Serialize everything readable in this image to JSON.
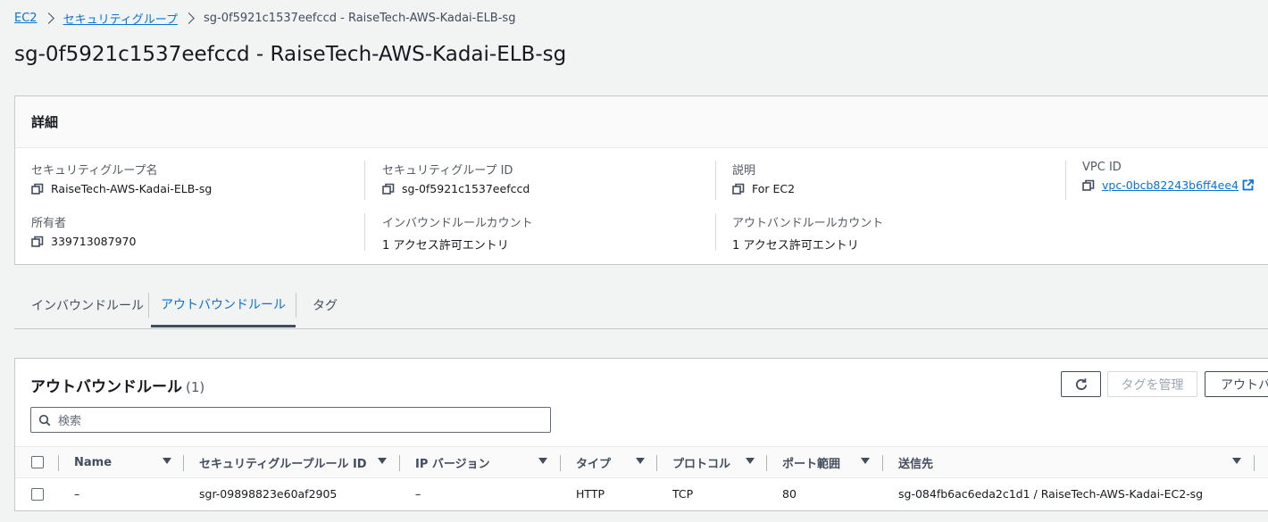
{
  "breadcrumb": {
    "items": [
      "EC2",
      "セキュリティグループ"
    ],
    "current": "sg-0f5921c1537eefccd - RaiseTech-AWS-Kadai-ELB-sg"
  },
  "page_title": "sg-0f5921c1537eefccd - RaiseTech-AWS-Kadai-ELB-sg",
  "details": {
    "title": "詳細",
    "sg_name_label": "セキュリティグループ名",
    "sg_name": "RaiseTech-AWS-Kadai-ELB-sg",
    "sg_id_label": "セキュリティグループ ID",
    "sg_id": "sg-0f5921c1537eefccd",
    "description_label": "説明",
    "description": "For EC2",
    "vpc_label": "VPC ID",
    "vpc_id": "vpc-0bcb82243b6ff4ee4",
    "owner_label": "所有者",
    "owner": "339713087970",
    "inbound_count_label": "インバウンドルールカウント",
    "inbound_count": "1 アクセス許可エントリ",
    "outbound_count_label": "アウトバンドルールカウント",
    "outbound_count": "1 アクセス許可エントリ"
  },
  "tabs": [
    "インバウンドルール",
    "アウトバウンドルール",
    "タグ"
  ],
  "active_tab": "アウトバウンドルール",
  "rules": {
    "title": "アウトバウンドルール",
    "count": "(1)",
    "manage_tags_label": "タグを管理",
    "edit_label": "アウトバ",
    "search_placeholder": "検索",
    "columns": [
      "Name",
      "セキュリティグループルール ID",
      "IP バージョン",
      "タイプ",
      "プロトコル",
      "ポート範囲",
      "送信先"
    ],
    "rows": [
      {
        "name": "–",
        "rule_id": "sgr-09898823e60af2905",
        "ip_version": "–",
        "type": "HTTP",
        "protocol": "TCP",
        "port": "80",
        "destination": "sg-084fb6ac6eda2c1d1 / RaiseTech-AWS-Kadai-EC2-sg"
      }
    ]
  },
  "colors": {
    "link": "#0972d3",
    "background": "#f2f3f3",
    "text": "#16191f"
  }
}
